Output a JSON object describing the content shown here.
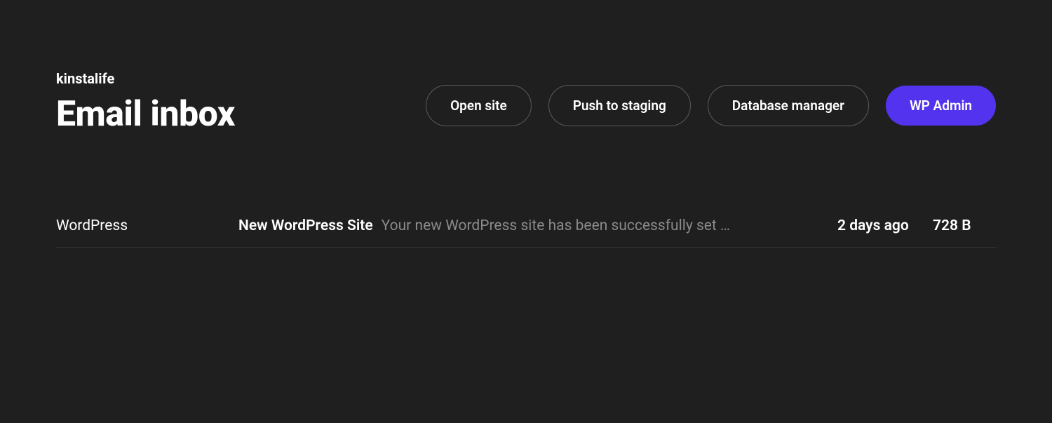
{
  "header": {
    "site_name": "kinstalife",
    "page_title": "Email inbox",
    "actions": {
      "open_site": "Open site",
      "push_to_staging": "Push to staging",
      "database_manager": "Database manager",
      "wp_admin": "WP Admin"
    }
  },
  "emails": [
    {
      "sender": "WordPress",
      "subject": "New WordPress Site",
      "preview": "Your new WordPress site has been successfully set …",
      "time": "2 days ago",
      "size": "728 B"
    }
  ]
}
